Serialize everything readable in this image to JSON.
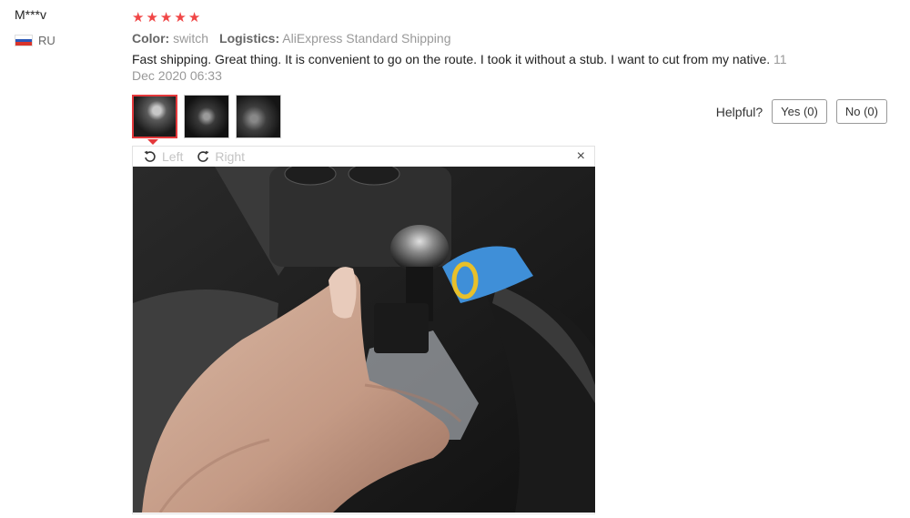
{
  "user": {
    "name": "M***v",
    "country": "RU"
  },
  "review": {
    "rating": 5,
    "color_label": "Color:",
    "color_value": "switch",
    "logistics_label": "Logistics:",
    "logistics_value": "AliExpress Standard Shipping",
    "text": "Fast shipping. Great thing. It is convenient to go on the route. I took it without a stub. I want to cut from my native.",
    "date": "11 Dec 2020 06:33"
  },
  "helpful": {
    "label": "Helpful?",
    "yes": "Yes (0)",
    "no": "No (0)"
  },
  "viewer": {
    "left": "Left",
    "right": "Right",
    "close": "×"
  },
  "colors": {
    "star": "#f04646",
    "active_border": "#e4393c"
  }
}
